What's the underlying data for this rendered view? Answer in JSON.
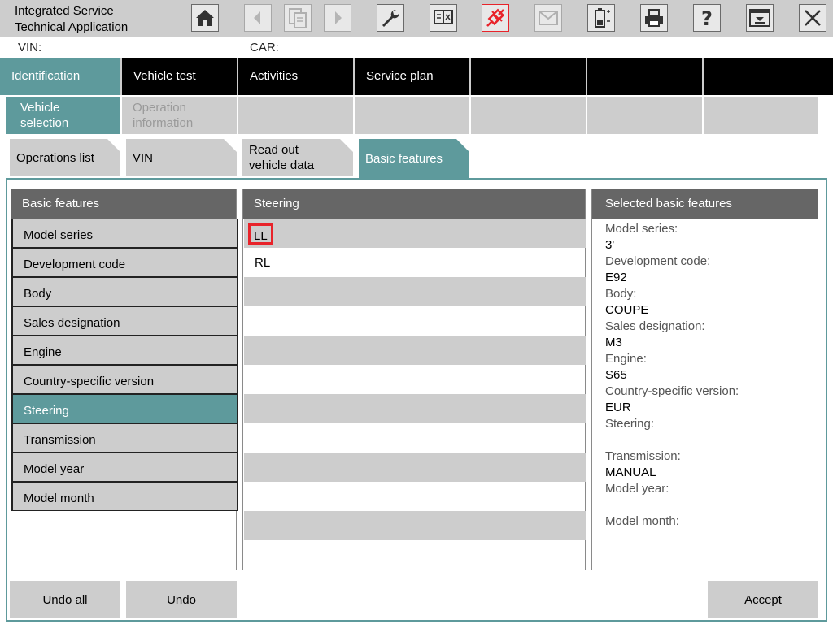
{
  "app": {
    "title_line1": "Integrated Service",
    "title_line2": "Technical Application"
  },
  "toolbar": {
    "icons": [
      "home-icon",
      "back-icon",
      "clipboard-icon",
      "forward-icon",
      "wrench-icon",
      "book-icon",
      "connection-icon",
      "mail-icon",
      "battery-icon",
      "printer-icon",
      "help-icon",
      "expand-icon",
      "close-icon"
    ],
    "accent": "#e8232a"
  },
  "info": {
    "vin_label": "VIN:",
    "car_label": "CAR:"
  },
  "main_nav": {
    "tabs": [
      {
        "label": "Identification",
        "active": true
      },
      {
        "label": "Vehicle test"
      },
      {
        "label": "Activities"
      },
      {
        "label": "Service plan"
      }
    ]
  },
  "sub_nav": {
    "tabs": [
      {
        "label_line1": "Vehicle",
        "label_line2": "selection",
        "active": true
      },
      {
        "label_line1": "Operation",
        "label_line2": "information"
      }
    ]
  },
  "breadcrumb": {
    "tabs": [
      {
        "label": "Operations list"
      },
      {
        "label": "VIN"
      },
      {
        "label_line1": "Read out",
        "label_line2": "vehicle data"
      },
      {
        "label": "Basic features",
        "active": true
      }
    ]
  },
  "features": {
    "header": "Basic features",
    "items": [
      "Model series",
      "Development code",
      "Body",
      "Sales designation",
      "Engine",
      "Country-specific version",
      "Steering",
      "Transmission",
      "Model year",
      "Model month"
    ],
    "selected": "Steering"
  },
  "steering": {
    "header": "Steering",
    "options": [
      "LL",
      "RL"
    ],
    "highlighted": "LL"
  },
  "summary": {
    "header": "Selected basic features",
    "entries": [
      {
        "label": "Model series:",
        "value": "3'"
      },
      {
        "label": "Development code:",
        "value": "E92"
      },
      {
        "label": "Body:",
        "value": "COUPE"
      },
      {
        "label": "Sales designation:",
        "value": "M3"
      },
      {
        "label": "Engine:",
        "value": "S65"
      },
      {
        "label": "Country-specific version:",
        "value": "EUR"
      },
      {
        "label": "Steering:",
        "value": ""
      },
      {
        "label": "Transmission:",
        "value": "MANUAL"
      },
      {
        "label": "Model year:",
        "value": ""
      },
      {
        "label": "Model month:",
        "value": ""
      }
    ]
  },
  "buttons": {
    "undo_all": "Undo all",
    "undo": "Undo",
    "accept": "Accept"
  },
  "colors": {
    "teal": "#5e9a9c",
    "grey": "#cdcdcd",
    "header_grey": "#666666"
  }
}
